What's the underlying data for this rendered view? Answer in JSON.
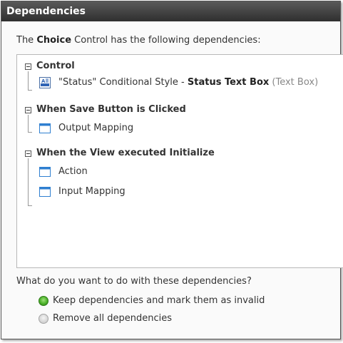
{
  "dialog": {
    "title": "Dependencies",
    "intro": {
      "prefix": "The ",
      "control_name": "Choice",
      "suffix": " Control has the following dependencies:"
    },
    "groups": [
      {
        "title": "Control",
        "items": [
          {
            "icon": "text-box-icon",
            "text_prefix": "\"Status\" Conditional Style - ",
            "text_bold": "Status Text Box",
            "text_suffix": " (Text Box)"
          }
        ]
      },
      {
        "title": "When Save Button is Clicked",
        "items": [
          {
            "icon": "window-icon",
            "text": "Output Mapping"
          }
        ]
      },
      {
        "title": "When the View executed Initialize",
        "items": [
          {
            "icon": "window-icon",
            "text": "Action"
          },
          {
            "icon": "window-icon",
            "text": "Input Mapping"
          }
        ]
      }
    ],
    "question": "What do you want to do with these dependencies?",
    "options": [
      {
        "label": "Keep dependencies and mark them as invalid",
        "selected": true
      },
      {
        "label": "Remove all dependencies",
        "selected": false
      }
    ]
  },
  "colors": {
    "titlebar": "#3a3a3a",
    "radio_selected": "#4cb22a",
    "window_icon": "#2f7fd0"
  }
}
